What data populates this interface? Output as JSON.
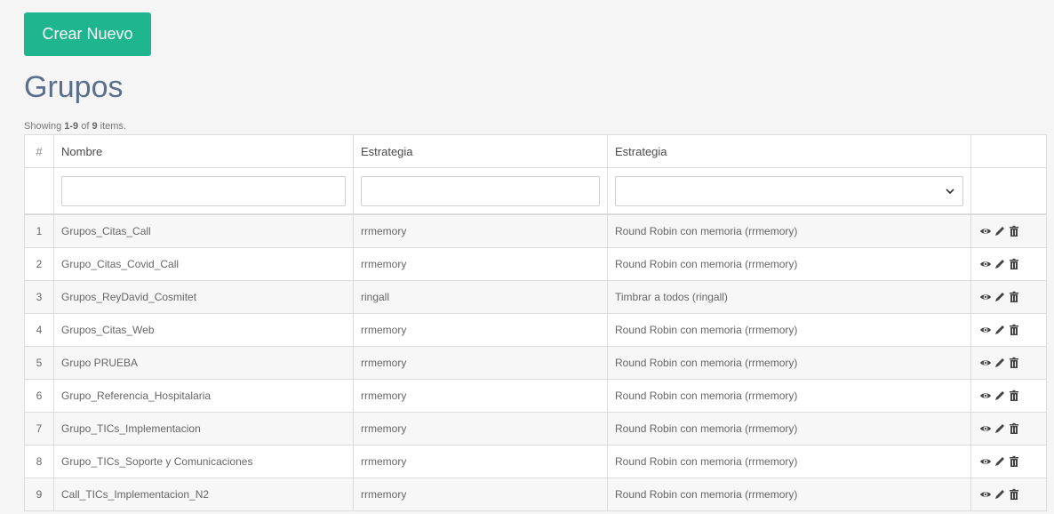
{
  "toolbar": {
    "create_label": "Crear Nuevo"
  },
  "page": {
    "title": "Grupos"
  },
  "summary": {
    "prefix": "Showing ",
    "range": "1-9",
    "middle": " of ",
    "total": "9",
    "suffix": " items."
  },
  "table": {
    "headers": {
      "index": "#",
      "name": "Nombre",
      "strategy": "Estrategia",
      "strategy_desc": "Estrategia"
    },
    "rows": [
      {
        "n": "1",
        "name": "Grupos_Citas_Call",
        "strategy": "rrmemory",
        "desc": "Round Robin con memoria (rrmemory)"
      },
      {
        "n": "2",
        "name": "Grupo_Citas_Covid_Call",
        "strategy": "rrmemory",
        "desc": "Round Robin con memoria (rrmemory)"
      },
      {
        "n": "3",
        "name": "Grupos_ReyDavid_Cosmitet",
        "strategy": "ringall",
        "desc": "Timbrar a todos (ringall)"
      },
      {
        "n": "4",
        "name": "Grupos_Citas_Web",
        "strategy": "rrmemory",
        "desc": "Round Robin con memoria (rrmemory)"
      },
      {
        "n": "5",
        "name": "Grupo PRUEBA",
        "strategy": "rrmemory",
        "desc": "Round Robin con memoria (rrmemory)"
      },
      {
        "n": "6",
        "name": "Grupo_Referencia_Hospitalaria",
        "strategy": "rrmemory",
        "desc": "Round Robin con memoria (rrmemory)"
      },
      {
        "n": "7",
        "name": "Grupo_TICs_Implementacion",
        "strategy": "rrmemory",
        "desc": "Round Robin con memoria (rrmemory)"
      },
      {
        "n": "8",
        "name": "Grupo_TICs_Soporte y Comunicaciones",
        "strategy": "rrmemory",
        "desc": "Round Robin con memoria (rrmemory)"
      },
      {
        "n": "9",
        "name": "Call_TICs_Implementacion_N2",
        "strategy": "rrmemory",
        "desc": "Round Robin con memoria (rrmemory)"
      }
    ]
  },
  "icons": {
    "view": "eye-icon",
    "edit": "pencil-icon",
    "delete": "trash-icon",
    "icon_color": "#444444"
  },
  "colors": {
    "accent": "#1eb58f",
    "title": "#5b6f8c"
  }
}
